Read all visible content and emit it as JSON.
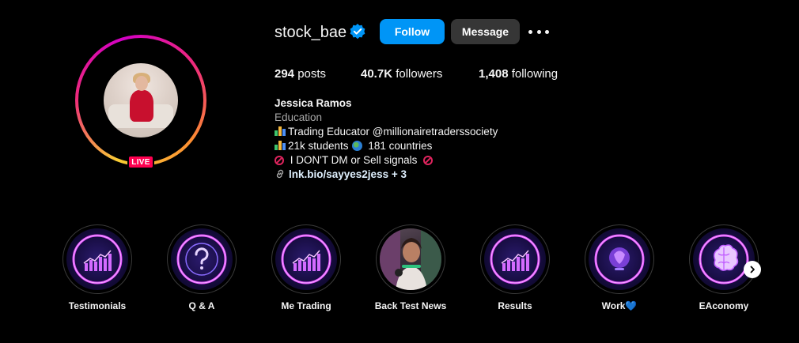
{
  "profile": {
    "username": "stock_bae",
    "live_label": "LIVE",
    "follow_label": "Follow",
    "message_label": "Message",
    "verified": true
  },
  "stats": {
    "posts_count": "294",
    "posts_label": "posts",
    "followers_count": "40.7K",
    "followers_label": "followers",
    "following_count": "1,408",
    "following_label": "following"
  },
  "bio": {
    "name": "Jessica Ramos",
    "category": "Education",
    "line1": "Trading Educator @millionairetraderssociety",
    "line2a": "21k students",
    "line2b": "181 countries",
    "line3": "I DON'T DM or Sell signals",
    "link": "lnk.bio/sayyes2jess + 3"
  },
  "highlights": [
    {
      "label": "Testimonials",
      "icon": "bar-chart-icon"
    },
    {
      "label": "Q & A",
      "icon": "question-mark-icon"
    },
    {
      "label": "Me Trading",
      "icon": "bar-chart-icon"
    },
    {
      "label": "Back Test News",
      "icon": "photo-thumbnail"
    },
    {
      "label": "Results",
      "icon": "bar-chart-icon"
    },
    {
      "label": "Work",
      "label_suffix": "💙",
      "icon": "head-silhouette-icon"
    },
    {
      "label": "EAconomy",
      "icon": "brain-icon"
    }
  ],
  "colors": {
    "follow": "#0095f6",
    "message": "#363636",
    "live": "#ff0050",
    "neon": "#e04bff"
  }
}
